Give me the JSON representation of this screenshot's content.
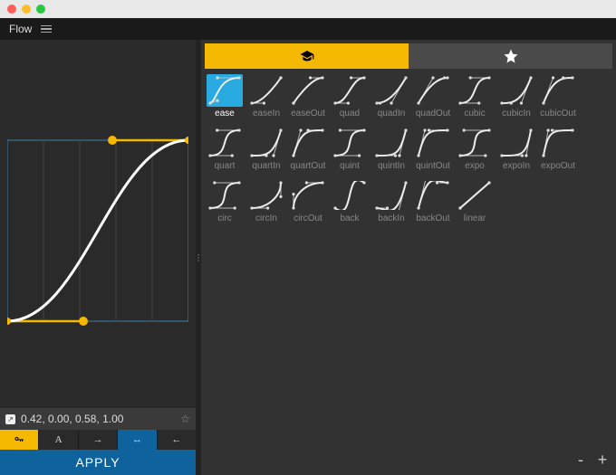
{
  "app": {
    "title": "Flow"
  },
  "curve": {
    "bezier": [
      0.42,
      0.0,
      0.58,
      1.0
    ],
    "display": "0.42, 0.00, 0.58, 1.00",
    "apply_label": "APPLY"
  },
  "toolbar": {
    "key_label": "🔑",
    "text_label": "A"
  },
  "presets": [
    {
      "name": "ease",
      "b": [
        0.25,
        0.1,
        0.25,
        1
      ],
      "selected": true
    },
    {
      "name": "easeIn",
      "b": [
        0.42,
        0,
        1,
        1
      ]
    },
    {
      "name": "easeOut",
      "b": [
        0,
        0,
        0.58,
        1
      ]
    },
    {
      "name": "quad",
      "b": [
        0.45,
        0,
        0.55,
        1
      ]
    },
    {
      "name": "quadIn",
      "b": [
        0.11,
        0,
        0.5,
        0
      ]
    },
    {
      "name": "quadOut",
      "b": [
        0.5,
        1,
        0.89,
        1
      ]
    },
    {
      "name": "cubic",
      "b": [
        0.65,
        0,
        0.35,
        1
      ]
    },
    {
      "name": "cubicIn",
      "b": [
        0.32,
        0,
        0.67,
        0
      ]
    },
    {
      "name": "cubicOut",
      "b": [
        0.33,
        1,
        0.68,
        1
      ]
    },
    {
      "name": "quart",
      "b": [
        0.76,
        0,
        0.24,
        1
      ]
    },
    {
      "name": "quartIn",
      "b": [
        0.5,
        0,
        0.75,
        0
      ]
    },
    {
      "name": "quartOut",
      "b": [
        0.25,
        1,
        0.5,
        1
      ]
    },
    {
      "name": "quint",
      "b": [
        0.83,
        0,
        0.17,
        1
      ]
    },
    {
      "name": "quintIn",
      "b": [
        0.64,
        0,
        0.78,
        0
      ]
    },
    {
      "name": "quintOut",
      "b": [
        0.22,
        1,
        0.36,
        1
      ]
    },
    {
      "name": "expo",
      "b": [
        0.87,
        0,
        0.13,
        1
      ]
    },
    {
      "name": "expoIn",
      "b": [
        0.7,
        0,
        0.84,
        0
      ]
    },
    {
      "name": "expoOut",
      "b": [
        0.16,
        1,
        0.3,
        1
      ]
    },
    {
      "name": "circ",
      "b": [
        0.85,
        0,
        0.15,
        1
      ]
    },
    {
      "name": "circIn",
      "b": [
        0.55,
        0,
        1,
        0.45
      ]
    },
    {
      "name": "circOut",
      "b": [
        0,
        0.55,
        0.45,
        1
      ]
    },
    {
      "name": "back",
      "b": [
        0.68,
        -0.6,
        0.32,
        1.6
      ]
    },
    {
      "name": "backIn",
      "b": [
        0.36,
        0,
        0.66,
        -0.56
      ]
    },
    {
      "name": "backOut",
      "b": [
        0.34,
        1.56,
        0.64,
        1
      ]
    },
    {
      "name": "linear",
      "b": [
        0,
        0,
        1,
        1
      ]
    }
  ],
  "zoom": {
    "minus": "-",
    "plus": "+"
  }
}
